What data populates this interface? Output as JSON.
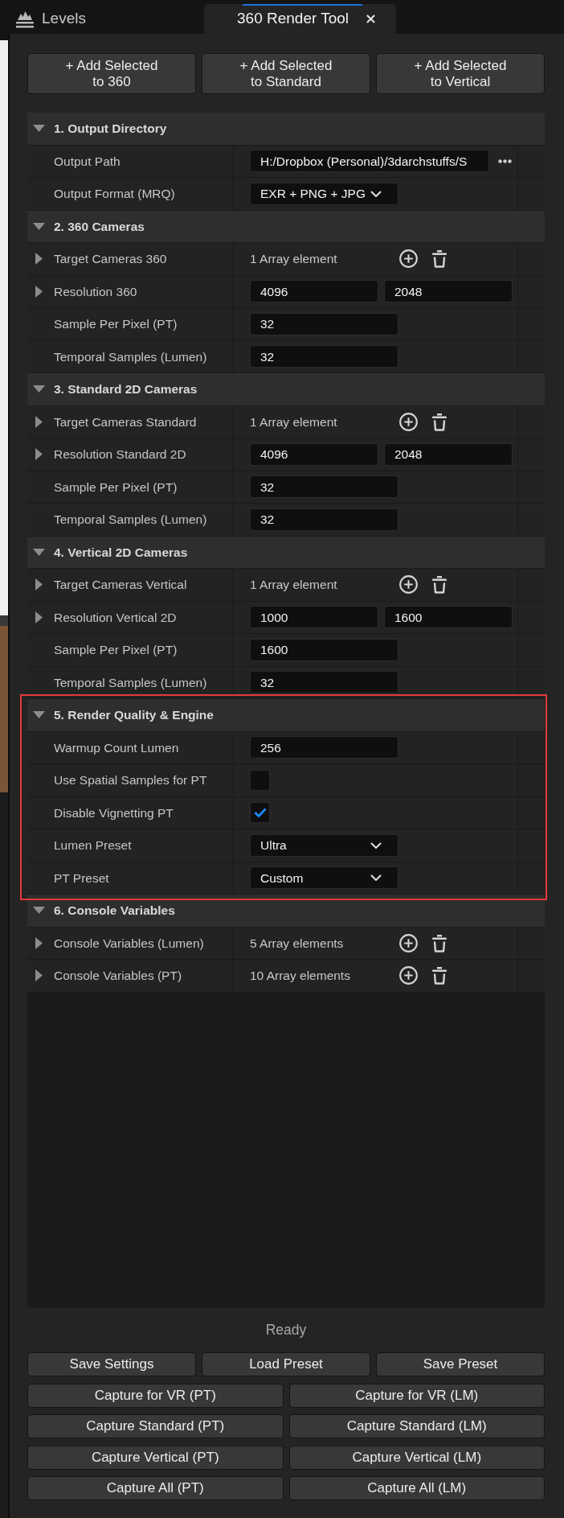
{
  "window": {
    "tabs": [
      {
        "label": "Levels",
        "selected": false,
        "closable": false
      },
      {
        "label": "360 Render Tool",
        "selected": true,
        "closable": true
      }
    ]
  },
  "add_buttons": [
    "+ Add Selected\nto 360",
    "+ Add Selected\nto Standard",
    "+ Add Selected\nto Vertical"
  ],
  "sections": [
    {
      "title": "1. Output Directory",
      "expanded": true,
      "highlighted": false,
      "rows": [
        {
          "kind": "path",
          "label": "Output Path",
          "value": "H:/Dropbox (Personal)/3darchstuffs/S"
        },
        {
          "kind": "dropdown",
          "label": "Output Format (MRQ)",
          "value": "EXR + PNG + JPG"
        }
      ]
    },
    {
      "title": "2. 360 Cameras",
      "expanded": true,
      "highlighted": false,
      "rows": [
        {
          "kind": "array",
          "label": "Target Cameras 360",
          "expanded": false,
          "value": "1 Array element"
        },
        {
          "kind": "pair",
          "label": "Resolution 360",
          "expanded": false,
          "values": [
            "4096",
            "2048"
          ]
        },
        {
          "kind": "number",
          "label": "Sample Per Pixel (PT)",
          "value": "32"
        },
        {
          "kind": "number",
          "label": "Temporal Samples (Lumen)",
          "value": "32"
        }
      ]
    },
    {
      "title": "3. Standard 2D Cameras",
      "expanded": true,
      "highlighted": false,
      "rows": [
        {
          "kind": "array",
          "label": "Target Cameras Standard",
          "expanded": false,
          "value": "1 Array element"
        },
        {
          "kind": "pair",
          "label": "Resolution Standard 2D",
          "expanded": false,
          "values": [
            "4096",
            "2048"
          ]
        },
        {
          "kind": "number",
          "label": "Sample Per Pixel (PT)",
          "value": "32"
        },
        {
          "kind": "number",
          "label": "Temporal Samples (Lumen)",
          "value": "32"
        }
      ]
    },
    {
      "title": "4. Vertical 2D Cameras",
      "expanded": true,
      "highlighted": false,
      "rows": [
        {
          "kind": "array",
          "label": "Target Cameras Vertical",
          "expanded": false,
          "value": "1 Array element"
        },
        {
          "kind": "pair",
          "label": "Resolution Vertical 2D",
          "expanded": false,
          "values": [
            "1000",
            "1600"
          ]
        },
        {
          "kind": "number",
          "label": "Sample Per Pixel (PT)",
          "value": "1600"
        },
        {
          "kind": "number",
          "label": "Temporal Samples (Lumen)",
          "value": "32"
        }
      ]
    },
    {
      "title": "5. Render Quality & Engine",
      "expanded": true,
      "highlighted": true,
      "rows": [
        {
          "kind": "number",
          "label": "Warmup Count Lumen",
          "value": "256"
        },
        {
          "kind": "checkbox",
          "label": "Use Spatial Samples for PT",
          "checked": false
        },
        {
          "kind": "checkbox",
          "label": "Disable Vignetting PT",
          "checked": true
        },
        {
          "kind": "dropdown",
          "label": "Lumen Preset",
          "value": "Ultra"
        },
        {
          "kind": "dropdown",
          "label": "PT Preset",
          "value": "Custom"
        }
      ]
    },
    {
      "title": "6. Console Variables",
      "expanded": true,
      "highlighted": false,
      "rows": [
        {
          "kind": "array",
          "label": "Console Variables (Lumen)",
          "expanded": false,
          "value": "5 Array elements"
        },
        {
          "kind": "array",
          "label": "Console Variables (PT)",
          "expanded": false,
          "value": "10 Array elements"
        }
      ]
    }
  ],
  "status": "Ready",
  "preset_buttons": [
    "Save Settings",
    "Load Preset",
    "Save Preset"
  ],
  "capture_buttons": [
    "Capture for VR (PT)",
    "Capture for VR (LM)",
    "Capture Standard (PT)",
    "Capture Standard (LM)",
    "Capture Vertical (PT)",
    "Capture Vertical (LM)",
    "Capture All (PT)",
    "Capture All (LM)"
  ]
}
